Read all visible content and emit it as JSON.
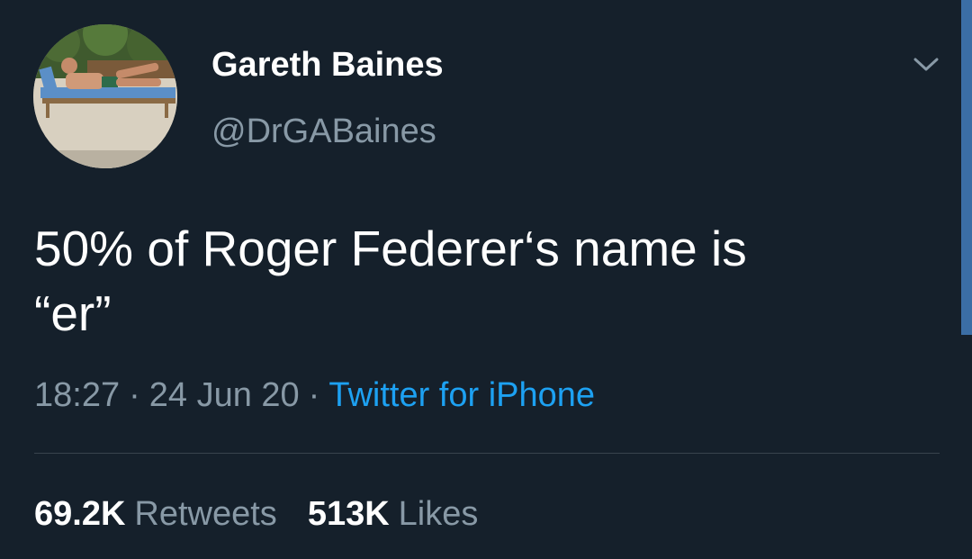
{
  "tweet": {
    "author": {
      "display_name": "Gareth Baines",
      "handle": "@DrGABaines",
      "avatar_icon": "profile-photo"
    },
    "text": "50% of Roger Federer‘s name is\n“er”",
    "meta": {
      "time": "18:27",
      "date": "24 Jun 20",
      "separator": "·",
      "source": "Twitter for iPhone"
    },
    "stats": {
      "retweets_count": "69.2K",
      "retweets_label": "Retweets",
      "likes_count": "513K",
      "likes_label": "Likes"
    },
    "menu_icon": "chevron-down-icon"
  },
  "colors": {
    "background": "#15202b",
    "primary_text": "#ffffff",
    "secondary_text": "#8899a6",
    "accent": "#1da1f2",
    "divider": "#38444d",
    "scrollbar": "#3b6ea5"
  }
}
